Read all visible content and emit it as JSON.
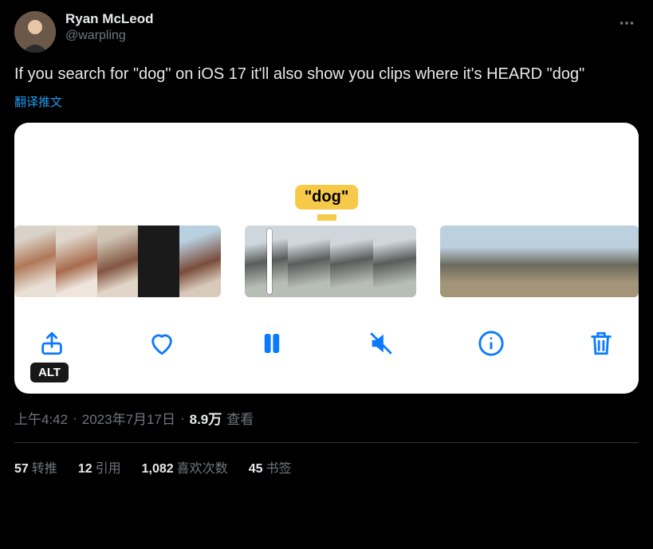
{
  "author": {
    "display_name": "Ryan McLeod",
    "handle": "@warpling"
  },
  "body": "If you search for \"dog\" on iOS 17 it'll also show you clips where it's HEARD \"dog\"",
  "translate_label": "翻译推文",
  "media": {
    "caption_tag": "\"dog\"",
    "alt_badge": "ALT",
    "toolbar": {
      "share": "share",
      "like": "like",
      "pause": "pause",
      "mute": "mute",
      "info": "info",
      "delete": "delete"
    }
  },
  "meta": {
    "time": "上午4:42",
    "separator": " · ",
    "date": "2023年7月17日",
    "views_count": "8.9万",
    "views_label": " 查看"
  },
  "stats": {
    "retweets": {
      "count": "57",
      "label": "转推"
    },
    "quotes": {
      "count": "12",
      "label": "引用"
    },
    "likes": {
      "count": "1,082",
      "label": "喜欢次数"
    },
    "bookmarks": {
      "count": "45",
      "label": "书签"
    }
  }
}
